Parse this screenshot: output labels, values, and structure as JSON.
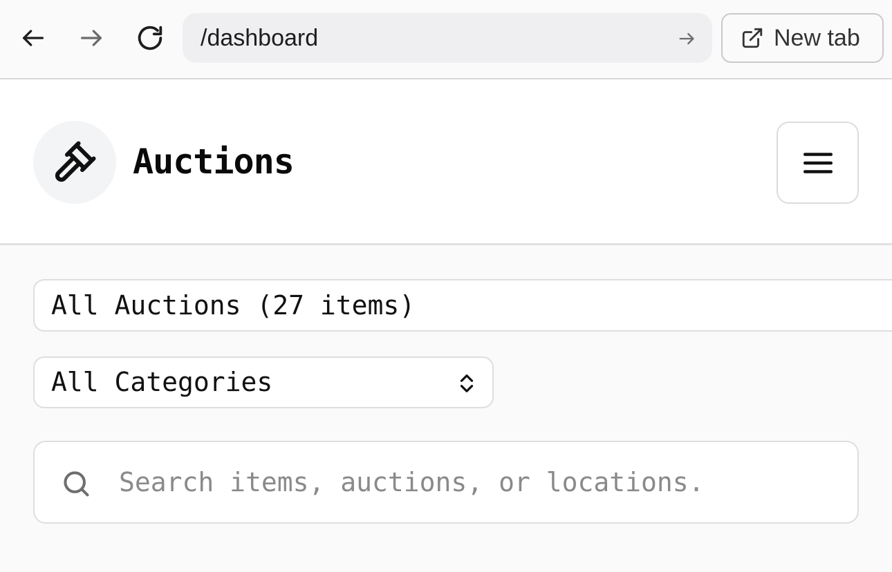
{
  "browser": {
    "url": "/dashboard",
    "new_tab_label": "New tab",
    "icons": {
      "back": "arrow-left-icon",
      "forward": "arrow-right-icon",
      "reload": "reload-icon",
      "go": "arrow-right-icon",
      "new_tab": "external-link-icon"
    }
  },
  "header": {
    "title": "Auctions",
    "logo_icon": "gavel-icon",
    "menu_icon": "hamburger-menu-icon"
  },
  "filters": {
    "auction_summary": "All Auctions (27 items)",
    "category_selected": "All Categories",
    "category_icon": "chevron-up-down-icon"
  },
  "search": {
    "placeholder": "Search items, auctions, or locations.",
    "value": "",
    "icon": "search-icon"
  },
  "colors": {
    "page_background": "#fafafa",
    "header_background": "#ffffff",
    "logo_background": "#f3f4f6",
    "url_bar_background": "#efeff1",
    "border": "#dedede",
    "text": "#111111",
    "placeholder": "#8a8a8a"
  }
}
